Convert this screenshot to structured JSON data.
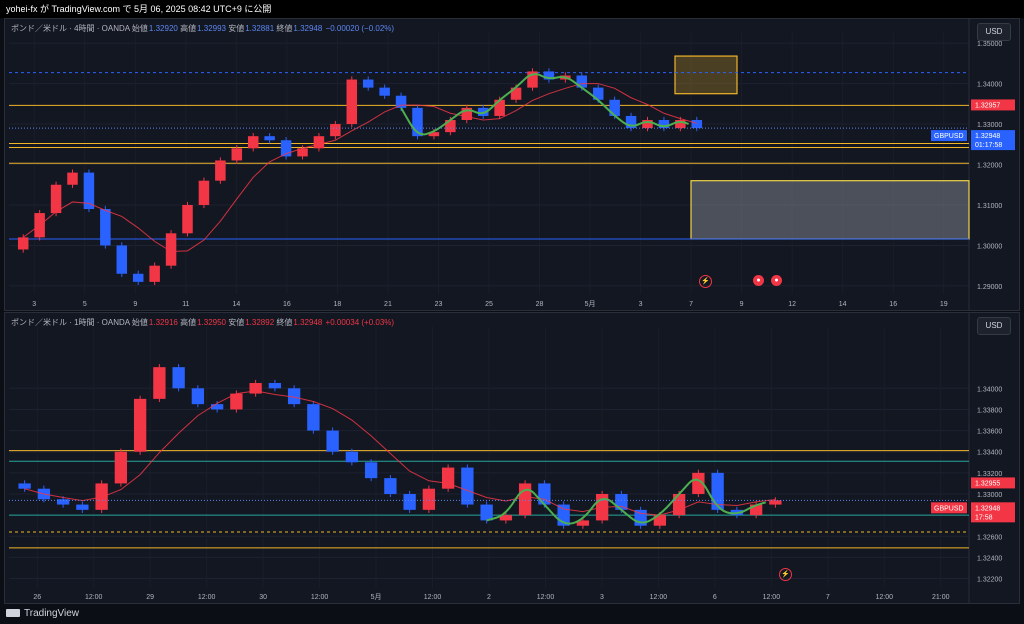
{
  "topbar": {
    "text": "yohei-fx が TradingView.com で 5月 06, 2025 08:42 UTC+9 に公開"
  },
  "footer": {
    "brand": "TradingView"
  },
  "colors": {
    "up": "#f23645",
    "down": "#2962ff",
    "ma": "#f23645",
    "wave": "#4caf50",
    "level": "#f0b429"
  },
  "pane1": {
    "legend": {
      "title": "ポンド／米ドル · 4時間 · OANDA",
      "o_label": "始値",
      "o": "1.32920",
      "h_label": "高値",
      "h": "1.32993",
      "l_label": "安値",
      "l": "1.32881",
      "c_label": "終値",
      "c": "1.32948",
      "chg": "−0.00020 (−0.02%)"
    },
    "currency": "USD",
    "symbol": "GBPUSD",
    "price_tag": "1.32948",
    "countdown": "01:17:58",
    "level_tag": "1.32957"
  },
  "pane2": {
    "legend": {
      "title": "ポンド／米ドル · 1時間 · OANDA",
      "o_label": "始値",
      "o": "1.32916",
      "h_label": "高値",
      "h": "1.32950",
      "l_label": "安値",
      "l": "1.32892",
      "c_label": "終値",
      "c": "1.32948",
      "chg": "+0.00034 (+0.03%)"
    },
    "currency": "USD",
    "symbol": "GBPUSD",
    "price_tag": "1.32948",
    "countdown": "17:58",
    "level_tag": "1.32955"
  },
  "chart_data": [
    {
      "type": "line",
      "subtype": "candlestick",
      "timeframe": "4h",
      "ylim": [
        1.288,
        1.3525
      ],
      "y_ticks": [
        "1.35000",
        "1.34000",
        "1.33000",
        "1.32000",
        "1.31000",
        "1.30000",
        "1.29000"
      ],
      "y_tick_values": [
        1.35,
        1.34,
        1.33,
        1.32,
        1.31,
        1.3,
        1.29
      ],
      "x_ticks": [
        "3",
        "5",
        "9",
        "11",
        "14",
        "16",
        "18",
        "21",
        "23",
        "25",
        "28",
        "5月",
        "3",
        "7",
        "9",
        "12",
        "14",
        "16",
        "19"
      ],
      "close_series": [
        1.302,
        1.308,
        1.315,
        1.318,
        1.309,
        1.3,
        1.293,
        1.291,
        1.295,
        1.303,
        1.31,
        1.316,
        1.321,
        1.324,
        1.327,
        1.326,
        1.322,
        1.324,
        1.327,
        1.33,
        1.341,
        1.339,
        1.337,
        1.334,
        1.327,
        1.328,
        1.331,
        1.334,
        1.332,
        1.336,
        1.339,
        1.343,
        1.341,
        1.342,
        1.339,
        1.336,
        1.332,
        1.329,
        1.331,
        1.329,
        1.331,
        1.329
      ],
      "horizontal_levels": [
        1.3427,
        1.3346,
        1.3252,
        1.3242,
        1.3203,
        1.3016
      ],
      "zones": [
        {
          "y_top": 1.3468,
          "y_bottom": 1.3375,
          "color": "#f0b429"
        },
        {
          "y_top": 1.316,
          "y_bottom": 1.3016,
          "color": "#f0d54a"
        }
      ]
    },
    {
      "type": "line",
      "subtype": "candlestick",
      "timeframe": "1h",
      "ylim": [
        1.3212,
        1.3458
      ],
      "y_ticks": [
        "1.34000",
        "1.33800",
        "1.33600",
        "1.33400",
        "1.33200",
        "1.33000",
        "1.32800",
        "1.32600",
        "1.32400",
        "1.32200"
      ],
      "y_tick_values": [
        1.34,
        1.338,
        1.336,
        1.334,
        1.332,
        1.33,
        1.328,
        1.326,
        1.324,
        1.322
      ],
      "x_ticks": [
        "26",
        "12:00",
        "29",
        "12:00",
        "30",
        "12:00",
        "5月",
        "12:00",
        "2",
        "12:00",
        "3",
        "12:00",
        "6",
        "12:00",
        "7",
        "12:00",
        "21:00"
      ],
      "close_series": [
        1.3305,
        1.3295,
        1.329,
        1.3285,
        1.331,
        1.334,
        1.339,
        1.342,
        1.34,
        1.3385,
        1.338,
        1.3395,
        1.3405,
        1.34,
        1.3385,
        1.336,
        1.334,
        1.333,
        1.3315,
        1.33,
        1.3285,
        1.3305,
        1.3325,
        1.329,
        1.3275,
        1.328,
        1.331,
        1.329,
        1.327,
        1.3275,
        1.33,
        1.3285,
        1.327,
        1.328,
        1.33,
        1.332,
        1.3285,
        1.328,
        1.329,
        1.3294
      ],
      "horizontal_levels": [
        1.3341,
        1.3331,
        1.328,
        1.3264,
        1.3249
      ]
    }
  ]
}
